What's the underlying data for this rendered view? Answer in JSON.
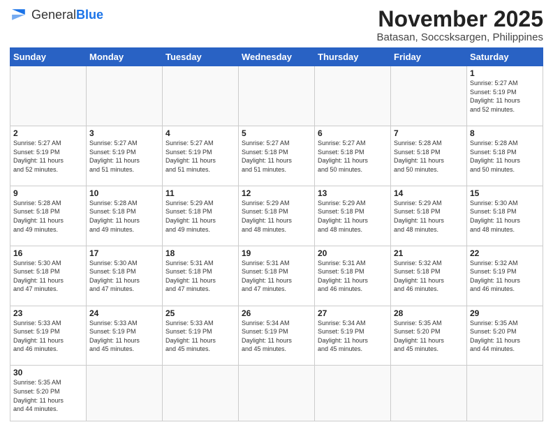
{
  "header": {
    "logo": "GeneralBlue",
    "month_title": "November 2025",
    "location": "Batasan, Soccsksargen, Philippines"
  },
  "days_of_week": [
    "Sunday",
    "Monday",
    "Tuesday",
    "Wednesday",
    "Thursday",
    "Friday",
    "Saturday"
  ],
  "weeks": [
    [
      {
        "day": "",
        "info": ""
      },
      {
        "day": "",
        "info": ""
      },
      {
        "day": "",
        "info": ""
      },
      {
        "day": "",
        "info": ""
      },
      {
        "day": "",
        "info": ""
      },
      {
        "day": "",
        "info": ""
      },
      {
        "day": "1",
        "info": "Sunrise: 5:27 AM\nSunset: 5:19 PM\nDaylight: 11 hours\nand 52 minutes."
      }
    ],
    [
      {
        "day": "2",
        "info": "Sunrise: 5:27 AM\nSunset: 5:19 PM\nDaylight: 11 hours\nand 52 minutes."
      },
      {
        "day": "3",
        "info": "Sunrise: 5:27 AM\nSunset: 5:19 PM\nDaylight: 11 hours\nand 51 minutes."
      },
      {
        "day": "4",
        "info": "Sunrise: 5:27 AM\nSunset: 5:19 PM\nDaylight: 11 hours\nand 51 minutes."
      },
      {
        "day": "5",
        "info": "Sunrise: 5:27 AM\nSunset: 5:18 PM\nDaylight: 11 hours\nand 51 minutes."
      },
      {
        "day": "6",
        "info": "Sunrise: 5:27 AM\nSunset: 5:18 PM\nDaylight: 11 hours\nand 50 minutes."
      },
      {
        "day": "7",
        "info": "Sunrise: 5:28 AM\nSunset: 5:18 PM\nDaylight: 11 hours\nand 50 minutes."
      },
      {
        "day": "8",
        "info": "Sunrise: 5:28 AM\nSunset: 5:18 PM\nDaylight: 11 hours\nand 50 minutes."
      }
    ],
    [
      {
        "day": "9",
        "info": "Sunrise: 5:28 AM\nSunset: 5:18 PM\nDaylight: 11 hours\nand 49 minutes."
      },
      {
        "day": "10",
        "info": "Sunrise: 5:28 AM\nSunset: 5:18 PM\nDaylight: 11 hours\nand 49 minutes."
      },
      {
        "day": "11",
        "info": "Sunrise: 5:29 AM\nSunset: 5:18 PM\nDaylight: 11 hours\nand 49 minutes."
      },
      {
        "day": "12",
        "info": "Sunrise: 5:29 AM\nSunset: 5:18 PM\nDaylight: 11 hours\nand 48 minutes."
      },
      {
        "day": "13",
        "info": "Sunrise: 5:29 AM\nSunset: 5:18 PM\nDaylight: 11 hours\nand 48 minutes."
      },
      {
        "day": "14",
        "info": "Sunrise: 5:29 AM\nSunset: 5:18 PM\nDaylight: 11 hours\nand 48 minutes."
      },
      {
        "day": "15",
        "info": "Sunrise: 5:30 AM\nSunset: 5:18 PM\nDaylight: 11 hours\nand 48 minutes."
      }
    ],
    [
      {
        "day": "16",
        "info": "Sunrise: 5:30 AM\nSunset: 5:18 PM\nDaylight: 11 hours\nand 47 minutes."
      },
      {
        "day": "17",
        "info": "Sunrise: 5:30 AM\nSunset: 5:18 PM\nDaylight: 11 hours\nand 47 minutes."
      },
      {
        "day": "18",
        "info": "Sunrise: 5:31 AM\nSunset: 5:18 PM\nDaylight: 11 hours\nand 47 minutes."
      },
      {
        "day": "19",
        "info": "Sunrise: 5:31 AM\nSunset: 5:18 PM\nDaylight: 11 hours\nand 47 minutes."
      },
      {
        "day": "20",
        "info": "Sunrise: 5:31 AM\nSunset: 5:18 PM\nDaylight: 11 hours\nand 46 minutes."
      },
      {
        "day": "21",
        "info": "Sunrise: 5:32 AM\nSunset: 5:18 PM\nDaylight: 11 hours\nand 46 minutes."
      },
      {
        "day": "22",
        "info": "Sunrise: 5:32 AM\nSunset: 5:19 PM\nDaylight: 11 hours\nand 46 minutes."
      }
    ],
    [
      {
        "day": "23",
        "info": "Sunrise: 5:33 AM\nSunset: 5:19 PM\nDaylight: 11 hours\nand 46 minutes."
      },
      {
        "day": "24",
        "info": "Sunrise: 5:33 AM\nSunset: 5:19 PM\nDaylight: 11 hours\nand 45 minutes."
      },
      {
        "day": "25",
        "info": "Sunrise: 5:33 AM\nSunset: 5:19 PM\nDaylight: 11 hours\nand 45 minutes."
      },
      {
        "day": "26",
        "info": "Sunrise: 5:34 AM\nSunset: 5:19 PM\nDaylight: 11 hours\nand 45 minutes."
      },
      {
        "day": "27",
        "info": "Sunrise: 5:34 AM\nSunset: 5:19 PM\nDaylight: 11 hours\nand 45 minutes."
      },
      {
        "day": "28",
        "info": "Sunrise: 5:35 AM\nSunset: 5:20 PM\nDaylight: 11 hours\nand 45 minutes."
      },
      {
        "day": "29",
        "info": "Sunrise: 5:35 AM\nSunset: 5:20 PM\nDaylight: 11 hours\nand 44 minutes."
      }
    ],
    [
      {
        "day": "30",
        "info": "Sunrise: 5:35 AM\nSunset: 5:20 PM\nDaylight: 11 hours\nand 44 minutes."
      },
      {
        "day": "",
        "info": ""
      },
      {
        "day": "",
        "info": ""
      },
      {
        "day": "",
        "info": ""
      },
      {
        "day": "",
        "info": ""
      },
      {
        "day": "",
        "info": ""
      },
      {
        "day": "",
        "info": ""
      }
    ]
  ]
}
